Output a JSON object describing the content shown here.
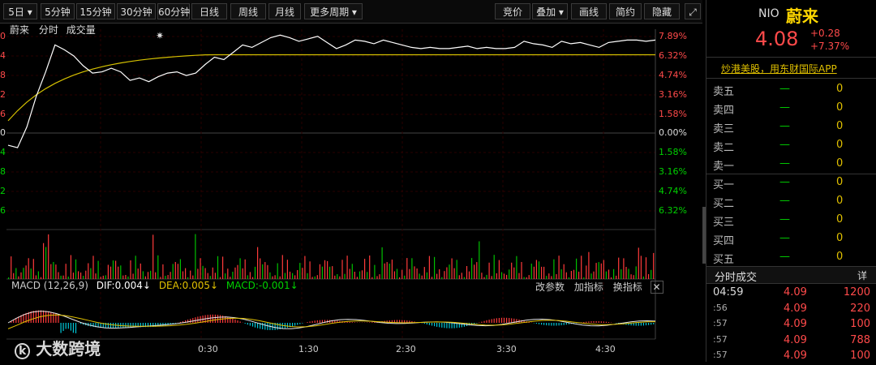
{
  "toolbar": {
    "period_5day": "5日",
    "period_5min": "5分钟",
    "period_15min": "15分钟",
    "period_30min": "30分钟",
    "period_60min": "60分钟",
    "period_day": "日线",
    "period_week": "周线",
    "period_month": "月线",
    "more_periods": "更多周期",
    "bid_price": "竞价",
    "overlay": "叠加",
    "draw_line": "画线",
    "simplified": "简约",
    "hide": "隐藏"
  },
  "chart_header": {
    "stock_name": "蔚来",
    "tab_timeshare": "分时",
    "tab_volume": "成交量"
  },
  "price_axis_right": [
    "7.89%",
    "6.32%",
    "4.74%",
    "3.16%",
    "1.58%",
    "0.00%",
    "1.58%",
    "3.16%",
    "4.74%",
    "6.32%"
  ],
  "price_axis_left_clipped": [
    "0",
    "4",
    "8",
    "2",
    "6",
    "0",
    "4",
    "8",
    "2",
    "6"
  ],
  "time_axis": [
    "0:30",
    "1:30",
    "2:30",
    "3:30",
    "4:30"
  ],
  "macd_bar": {
    "label": "MACD (12,26,9)",
    "dif": "DIF:0.004↓",
    "dea": "DEA:0.005↓",
    "macd": "MACD:-0.001↓",
    "change_params": "改参数",
    "add_indicator": "加指标",
    "switch_indicator": "换指标"
  },
  "watermark": "大数跨境",
  "quote": {
    "code": "NIO",
    "name": "蔚来",
    "price": "4.08",
    "change": "+0.28",
    "change_pct": "+7.37%",
    "promo": "炒港美股，用东财国际APP",
    "sell": [
      {
        "label": "卖五",
        "price": "—",
        "vol": "0"
      },
      {
        "label": "卖四",
        "price": "—",
        "vol": "0"
      },
      {
        "label": "卖三",
        "price": "—",
        "vol": "0"
      },
      {
        "label": "卖二",
        "price": "—",
        "vol": "0"
      },
      {
        "label": "卖一",
        "price": "—",
        "vol": "0"
      }
    ],
    "buy": [
      {
        "label": "买一",
        "price": "—",
        "vol": "0"
      },
      {
        "label": "买二",
        "price": "—",
        "vol": "0"
      },
      {
        "label": "买三",
        "price": "—",
        "vol": "0"
      },
      {
        "label": "买四",
        "price": "—",
        "vol": "0"
      },
      {
        "label": "买五",
        "price": "—",
        "vol": "0"
      }
    ],
    "trades_title": "分时成交",
    "trades_detail": "详",
    "trades": [
      {
        "time": "04:59",
        "price": "4.09",
        "vol": "1200"
      },
      {
        "time": ":56",
        "price": "4.09",
        "vol": "220"
      },
      {
        "time": ":57",
        "price": "4.09",
        "vol": "100"
      },
      {
        "time": ":57",
        "price": "4.09",
        "vol": "788"
      },
      {
        "time": ":57",
        "price": "4.09",
        "vol": "100"
      }
    ]
  },
  "colors": {
    "up": "#ff4a4a",
    "down": "#00d000",
    "price_line": "#ffffff",
    "avg_line": "#e0c000"
  }
}
